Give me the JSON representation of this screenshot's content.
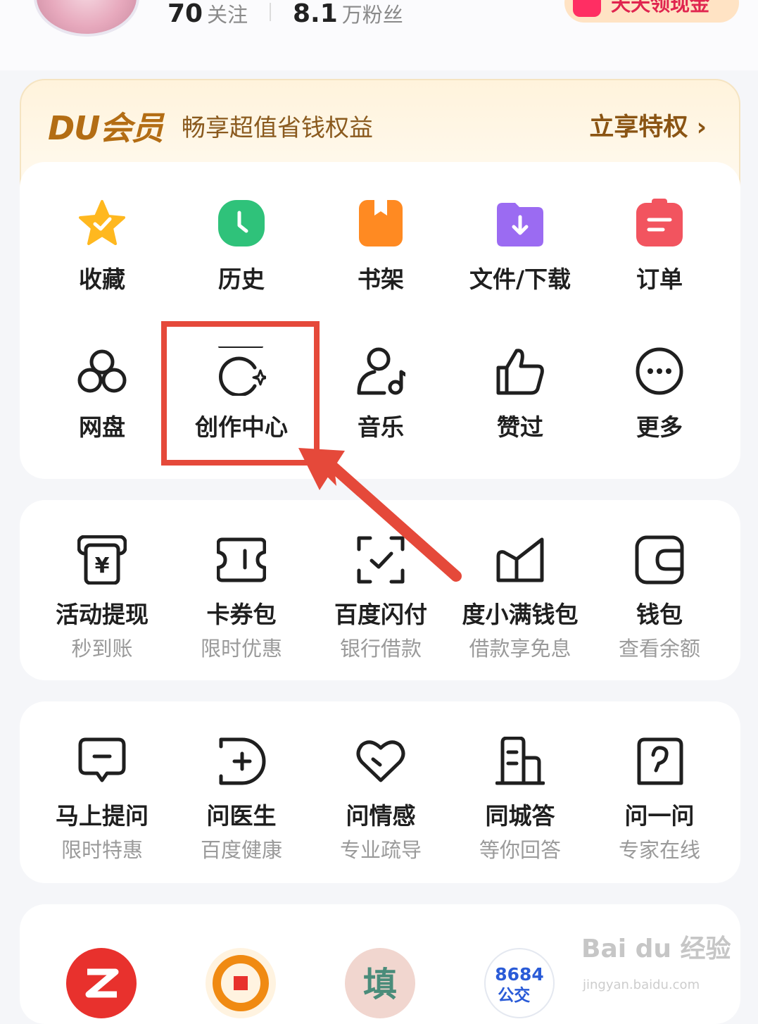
{
  "header": {
    "following_count": "70",
    "following_label": "关注",
    "followers_count": "8.1",
    "followers_label": "万粉丝",
    "cash_button_label": "天天领现金"
  },
  "vip": {
    "brand": "DU会员",
    "slogan": "畅享超值省钱权益",
    "link_label": "立享特权 ›"
  },
  "quick_actions": [
    {
      "label": "收藏",
      "icon": "star-icon",
      "color": "#ffb81f"
    },
    {
      "label": "历史",
      "icon": "clock-icon",
      "color": "#2fc27a"
    },
    {
      "label": "书架",
      "icon": "bookshelf-icon",
      "color": "#ff8a22"
    },
    {
      "label": "文件/下载",
      "icon": "folder-download-icon",
      "color": "#9b6bf2"
    },
    {
      "label": "订单",
      "icon": "order-icon",
      "color": "#f2545f"
    },
    {
      "label": "网盘",
      "icon": "cloud-drive-icon"
    },
    {
      "label": "创作中心",
      "icon": "creator-center-icon"
    },
    {
      "label": "音乐",
      "icon": "music-icon"
    },
    {
      "label": "赞过",
      "icon": "thumbs-up-icon"
    },
    {
      "label": "更多",
      "icon": "more-icon"
    }
  ],
  "finance": [
    {
      "label": "活动提现",
      "sub": "秒到账",
      "icon": "cash-withdraw-icon"
    },
    {
      "label": "卡券包",
      "sub": "限时优惠",
      "icon": "coupon-icon"
    },
    {
      "label": "百度闪付",
      "sub": "银行借款",
      "icon": "scan-pay-icon"
    },
    {
      "label": "度小满钱包",
      "sub": "借款享免息",
      "icon": "duxiaoman-icon"
    },
    {
      "label": "钱包",
      "sub": "查看余额",
      "icon": "wallet-icon"
    }
  ],
  "services": [
    {
      "label": "马上提问",
      "sub": "限时特惠",
      "icon": "ask-question-icon"
    },
    {
      "label": "问医生",
      "sub": "百度健康",
      "icon": "doctor-icon"
    },
    {
      "label": "问情感",
      "sub": "专业疏导",
      "icon": "heart-icon"
    },
    {
      "label": "同城答",
      "sub": "等你回答",
      "icon": "building-icon"
    },
    {
      "label": "问一问",
      "sub": "专家在线",
      "icon": "question-icon"
    }
  ],
  "bottom_apps": [
    "zhihu-app-icon",
    "baidu-wallet-app-icon",
    "tian-app-icon",
    "bus-app-icon"
  ],
  "bottom_app_texts": {
    "tian": "填",
    "bus_top": "8684",
    "bus_bottom": "公交"
  },
  "watermark": {
    "text": "Bai du 经验",
    "sub": "jingyan.baidu.com"
  },
  "accent_color": "#e5493a"
}
